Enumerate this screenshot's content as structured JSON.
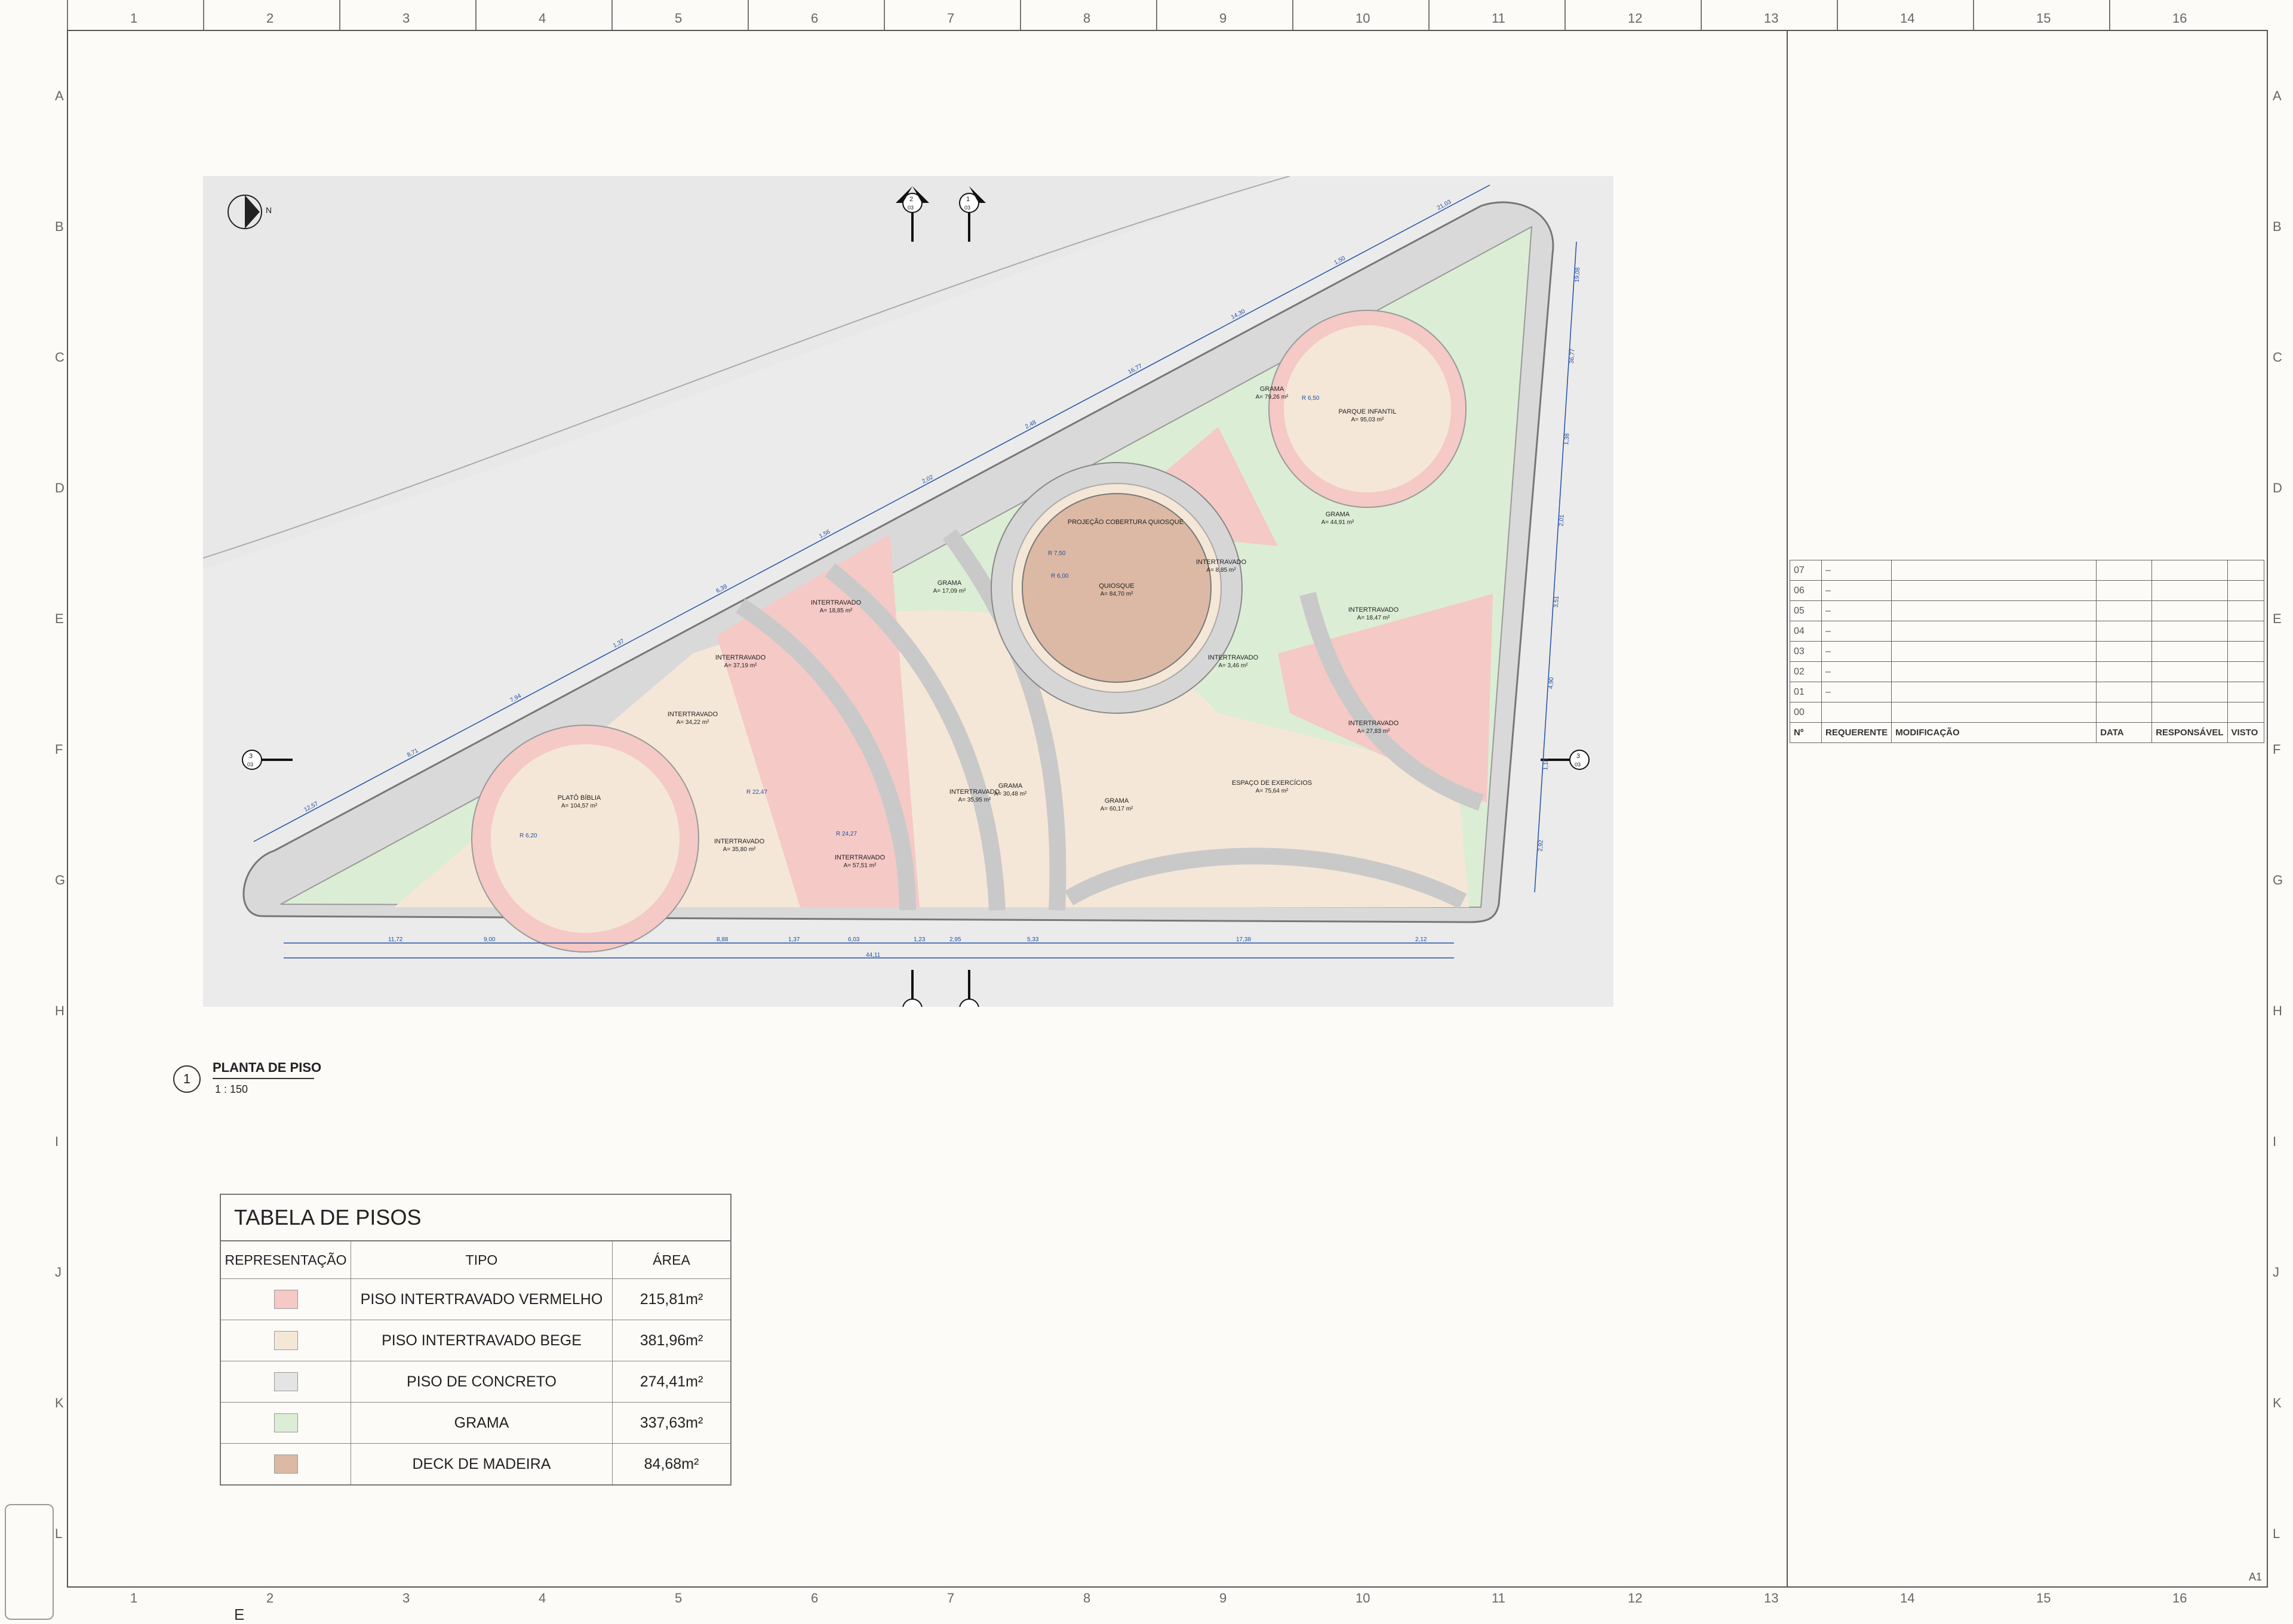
{
  "ruler": {
    "columns": [
      "1",
      "2",
      "3",
      "4",
      "5",
      "6",
      "7",
      "8",
      "9",
      "10",
      "11",
      "12",
      "13",
      "14",
      "15",
      "16"
    ],
    "rows": [
      "A",
      "B",
      "C",
      "D",
      "E",
      "F",
      "G",
      "H",
      "I",
      "J",
      "K",
      "L"
    ]
  },
  "plan": {
    "north_label": "N",
    "section_marks": [
      {
        "number": "2",
        "sheet": "03"
      },
      {
        "number": "1",
        "sheet": "03"
      },
      {
        "number": "3",
        "sheet": "03"
      }
    ],
    "areas": [
      {
        "name": "GRAMA",
        "area": "A= 79,26 m²"
      },
      {
        "name": "PARQUE INFANTIL",
        "area": "A= 95,03 m²"
      },
      {
        "name": "GRAMA",
        "area": "A= 44,91 m²"
      },
      {
        "name": "PROJEÇÃO COBERTURA QUIOSQUE",
        "area": ""
      },
      {
        "name": "QUIOSQUE",
        "area": "A= 84,70 m²"
      },
      {
        "name": "INTERTRAVADO",
        "area": "A= 8,85 m²"
      },
      {
        "name": "INTERTRAVADO",
        "area": "A= 18,47 m²"
      },
      {
        "name": "INTERTRAVADO",
        "area": "A= 3,46 m²"
      },
      {
        "name": "INTERTRAVADO",
        "area": "A= 27,83 m²"
      },
      {
        "name": "ESPAÇO DE EXERCÍCIOS",
        "area": "A= 75,64 m²"
      },
      {
        "name": "GRAMA",
        "area": "A= 60,17 m²"
      },
      {
        "name": "GRAMA",
        "area": "A= 30,48 m²"
      },
      {
        "name": "INTERTRAVADO",
        "area": "A= 35,95 m²"
      },
      {
        "name": "GRAMA",
        "area": "A= 17,09 m²"
      },
      {
        "name": "INTERTRAVADO",
        "area": "A= 18,85 m²"
      },
      {
        "name": "INTERTRAVADO",
        "area": "A= 37,19 m²"
      },
      {
        "name": "INTERTRAVADO",
        "area": "A= 34,22 m²"
      },
      {
        "name": "PLATÔ BÍBLIA",
        "area": "A= 104,57 m²"
      },
      {
        "name": "INTERTRAVADO",
        "area": "A= 35,80 m²"
      },
      {
        "name": "INTERTRAVADO",
        "area": "A= 57,51 m²"
      }
    ],
    "bottom_dims": [
      "11,72",
      "9,00",
      "8,88",
      "1,37",
      "6,03",
      "1,23",
      "2,95",
      "5,33",
      "17,38",
      "2,12"
    ],
    "total_dim": "44,11",
    "slope_dims": [
      "12,57",
      "8,71",
      "7,94",
      "1,37",
      "6,39",
      "1,56",
      "2,02",
      "2,48",
      "16,77",
      "14,30",
      "1,50",
      "21,03"
    ],
    "radius_dims": [
      "R 6,20",
      "R 24,27",
      "R 22,47",
      "R 6,00",
      "R 7,50",
      "R 6,50"
    ],
    "right_dims": [
      "19,08",
      "36,77",
      "1,38",
      "2,01",
      "3,51",
      "4,90",
      "1,18",
      "2,92"
    ]
  },
  "view": {
    "number": "1",
    "title": "PLANTA DE PISO",
    "scale": "1 : 150"
  },
  "floor_table": {
    "title": "TABELA DE PISOS",
    "headers": [
      "REPRESENTAÇÃO",
      "TIPO",
      "ÁREA"
    ],
    "rows": [
      {
        "color": "#f4c9c6",
        "type": "PISO INTERTRAVADO VERMELHO",
        "area": "215,81m²"
      },
      {
        "color": "#f5e7d7",
        "type": "PISO INTERTRAVADO BEGE",
        "area": "381,96m²"
      },
      {
        "color": "#e4e4e4",
        "type": "PISO DE CONCRETO",
        "area": "274,41m²"
      },
      {
        "color": "#dcedd5",
        "type": "GRAMA",
        "area": "337,63m²"
      },
      {
        "color": "#dcb9a4",
        "type": "DECK DE MADEIRA",
        "area": "84,68m²"
      }
    ]
  },
  "revisions": {
    "rows": [
      {
        "num": "07",
        "value": "–"
      },
      {
        "num": "06",
        "value": "–"
      },
      {
        "num": "05",
        "value": "–"
      },
      {
        "num": "04",
        "value": "–"
      },
      {
        "num": "03",
        "value": "–"
      },
      {
        "num": "02",
        "value": "–"
      },
      {
        "num": "01",
        "value": "–"
      },
      {
        "num": "00",
        "value": ""
      }
    ],
    "headers": [
      "Nº",
      "REQUERENTE",
      "MODIFICAÇÃO",
      "DATA",
      "RESPONSÁVEL",
      "VISTO"
    ]
  },
  "sheet_size": "A1",
  "footer_letter": "E"
}
